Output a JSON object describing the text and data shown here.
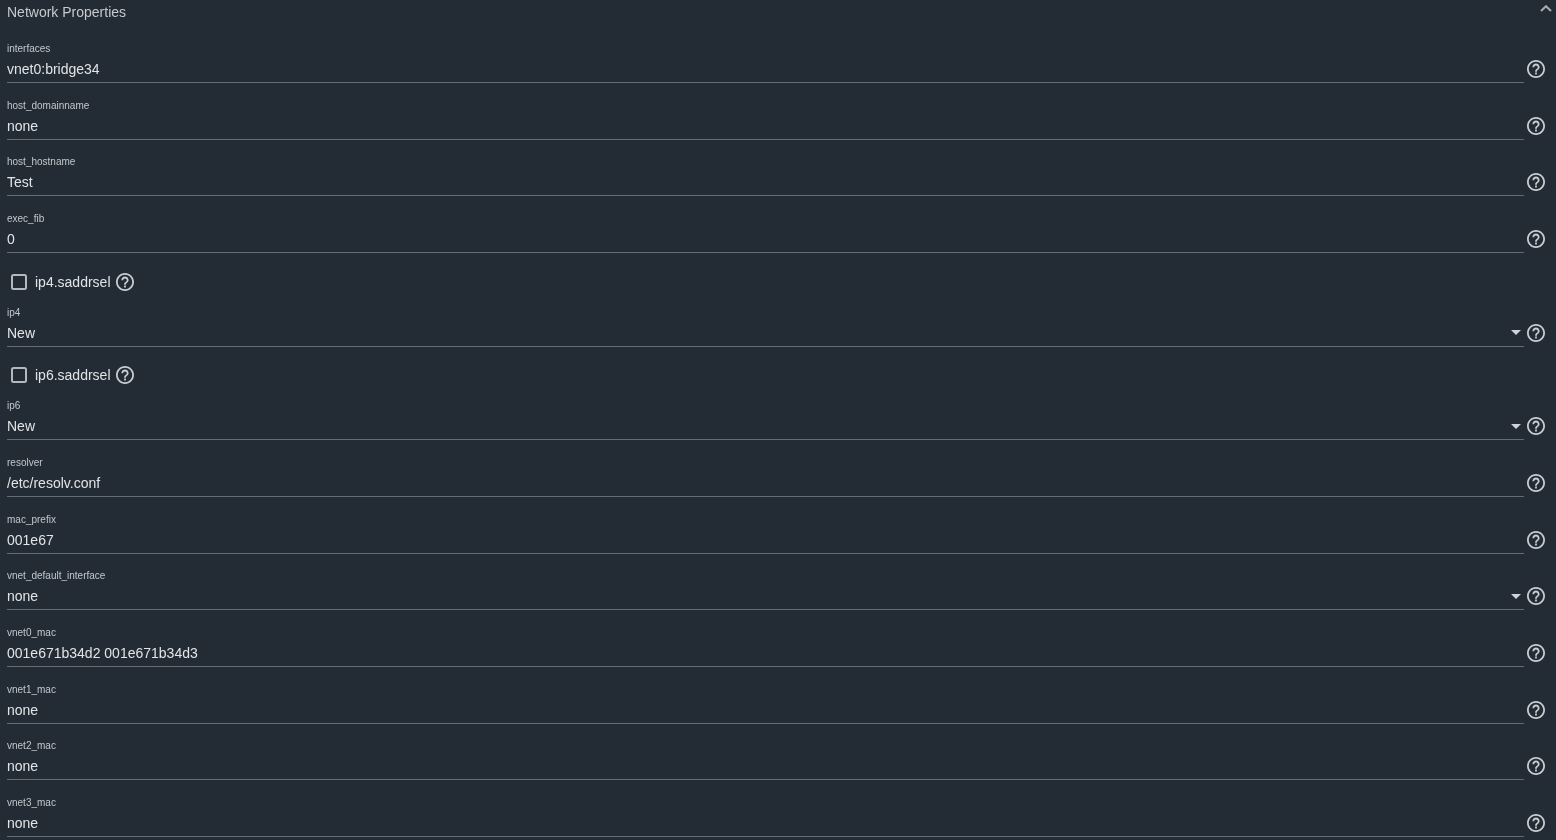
{
  "section": {
    "title": "Network Properties",
    "expanded": true
  },
  "fields": [
    {
      "kind": "text",
      "label": "interfaces",
      "value": "vnet0:bridge34"
    },
    {
      "kind": "text",
      "label": "host_domainname",
      "value": "none"
    },
    {
      "kind": "text",
      "label": "host_hostname",
      "value": "Test"
    },
    {
      "kind": "text",
      "label": "exec_fib",
      "value": "0"
    },
    {
      "kind": "checkbox",
      "label": "ip4.saddrsel",
      "checked": false
    },
    {
      "kind": "select",
      "label": "ip4",
      "value": "New"
    },
    {
      "kind": "checkbox",
      "label": "ip6.saddrsel",
      "checked": false
    },
    {
      "kind": "select",
      "label": "ip6",
      "value": "New"
    },
    {
      "kind": "text",
      "label": "resolver",
      "value": "/etc/resolv.conf"
    },
    {
      "kind": "text",
      "label": "mac_prefix",
      "value": "001e67"
    },
    {
      "kind": "select",
      "label": "vnet_default_interface",
      "value": "none"
    },
    {
      "kind": "text",
      "label": "vnet0_mac",
      "value": "001e671b34d2 001e671b34d3"
    },
    {
      "kind": "text",
      "label": "vnet1_mac",
      "value": "none"
    },
    {
      "kind": "text",
      "label": "vnet2_mac",
      "value": "none"
    },
    {
      "kind": "text",
      "label": "vnet3_mac",
      "value": "none"
    }
  ]
}
